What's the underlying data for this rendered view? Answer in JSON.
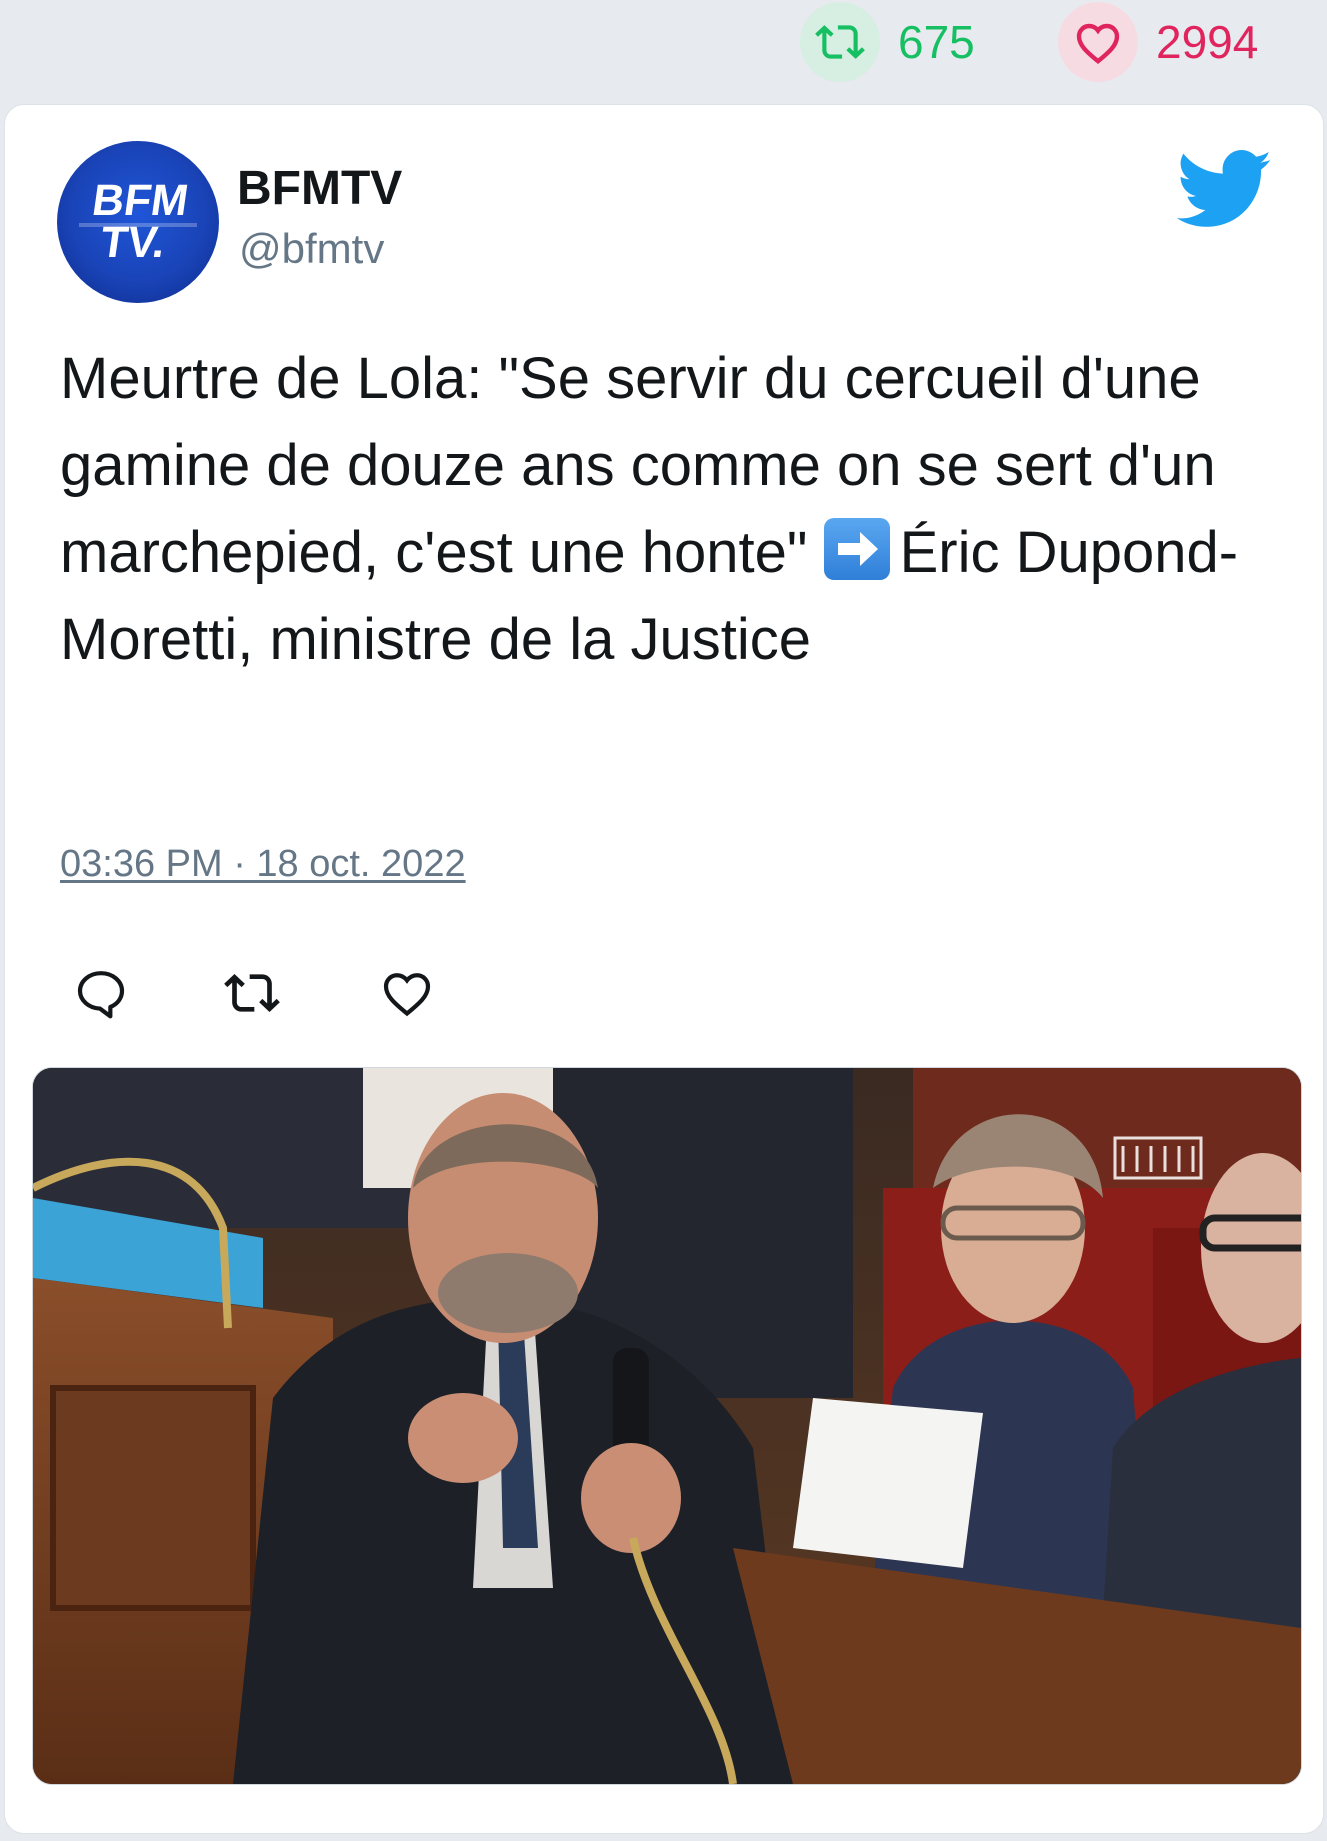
{
  "stats": {
    "retweets": "675",
    "likes": "2994",
    "retweet_icon": "retweet-icon",
    "like_icon": "heart-icon"
  },
  "tweet": {
    "author_name": "BFMTV",
    "author_handle": "@bfmtv",
    "avatar_text_line1": "BFM",
    "avatar_text_line2": "TV.",
    "text_part1": "Meurtre de Lola: \"Se servir du cercueil d'une gamine de douze ans comme on se sert d'un marchepied, c'est une honte\" ",
    "emoji": "arrow-right-emoji",
    "text_part2": "Éric Dupond-Moretti, ministre de la Justice",
    "timestamp": "03:36 PM · 18 oct. 2022",
    "actions": [
      "reply-icon",
      "retweet-icon",
      "like-icon"
    ],
    "media": "photo of a speaker at a microphone in a parliamentary chamber"
  },
  "colors": {
    "retweet_green": "#17bf63",
    "like_red": "#e0245e",
    "twitter_blue": "#1da1f2",
    "text": "#14171a",
    "muted": "#657786"
  }
}
